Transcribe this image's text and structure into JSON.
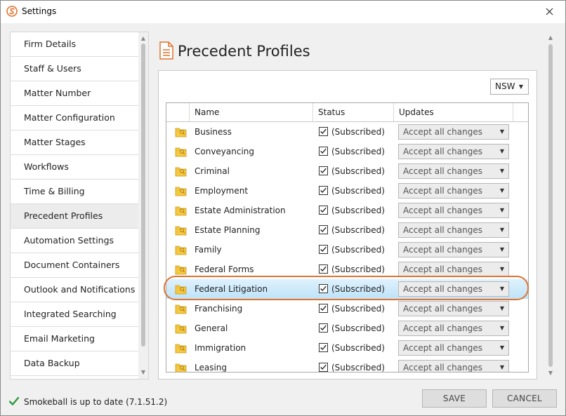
{
  "window": {
    "title": "Settings"
  },
  "sidebar": {
    "items": [
      {
        "label": "Firm Details"
      },
      {
        "label": "Staff & Users"
      },
      {
        "label": "Matter Number"
      },
      {
        "label": "Matter Configuration"
      },
      {
        "label": "Matter Stages"
      },
      {
        "label": "Workflows"
      },
      {
        "label": "Time & Billing"
      },
      {
        "label": "Precedent Profiles",
        "active": true
      },
      {
        "label": "Automation Settings"
      },
      {
        "label": "Document Containers"
      },
      {
        "label": "Outlook and Notifications"
      },
      {
        "label": "Integrated Searching"
      },
      {
        "label": "Email Marketing"
      },
      {
        "label": "Data Backup"
      }
    ]
  },
  "page": {
    "title": "Precedent Profiles",
    "icon": "document-icon"
  },
  "region": {
    "selected": "NSW"
  },
  "table": {
    "columns": [
      "Name",
      "Status",
      "Updates"
    ],
    "rows": [
      {
        "name": "Business",
        "status": "(Subscribed)",
        "update": "Accept all changes"
      },
      {
        "name": "Conveyancing",
        "status": "(Subscribed)",
        "update": "Accept all changes"
      },
      {
        "name": "Criminal",
        "status": "(Subscribed)",
        "update": "Accept all changes"
      },
      {
        "name": "Employment",
        "status": "(Subscribed)",
        "update": "Accept all changes"
      },
      {
        "name": "Estate Administration",
        "status": "(Subscribed)",
        "update": "Accept all changes"
      },
      {
        "name": "Estate Planning",
        "status": "(Subscribed)",
        "update": "Accept all changes"
      },
      {
        "name": "Family",
        "status": "(Subscribed)",
        "update": "Accept all changes"
      },
      {
        "name": "Federal Forms",
        "status": "(Subscribed)",
        "update": "Accept all changes"
      },
      {
        "name": "Federal Litigation",
        "status": "(Subscribed)",
        "update": "Accept all changes",
        "selected": true
      },
      {
        "name": "Franchising",
        "status": "(Subscribed)",
        "update": "Accept all changes"
      },
      {
        "name": "General",
        "status": "(Subscribed)",
        "update": "Accept all changes"
      },
      {
        "name": "Immigration",
        "status": "(Subscribed)",
        "update": "Accept all changes"
      },
      {
        "name": "Leasing",
        "status": "(Subscribed)",
        "update": "Accept all changes"
      }
    ]
  },
  "footer": {
    "status": "Smokeball is up to date (7.1.51.2)",
    "save_label": "SAVE",
    "cancel_label": "CANCEL"
  },
  "colors": {
    "accent": "#e0732f",
    "selection": "#bfe3f8",
    "folder": "#f5c842",
    "check": "#2e9a3e"
  }
}
